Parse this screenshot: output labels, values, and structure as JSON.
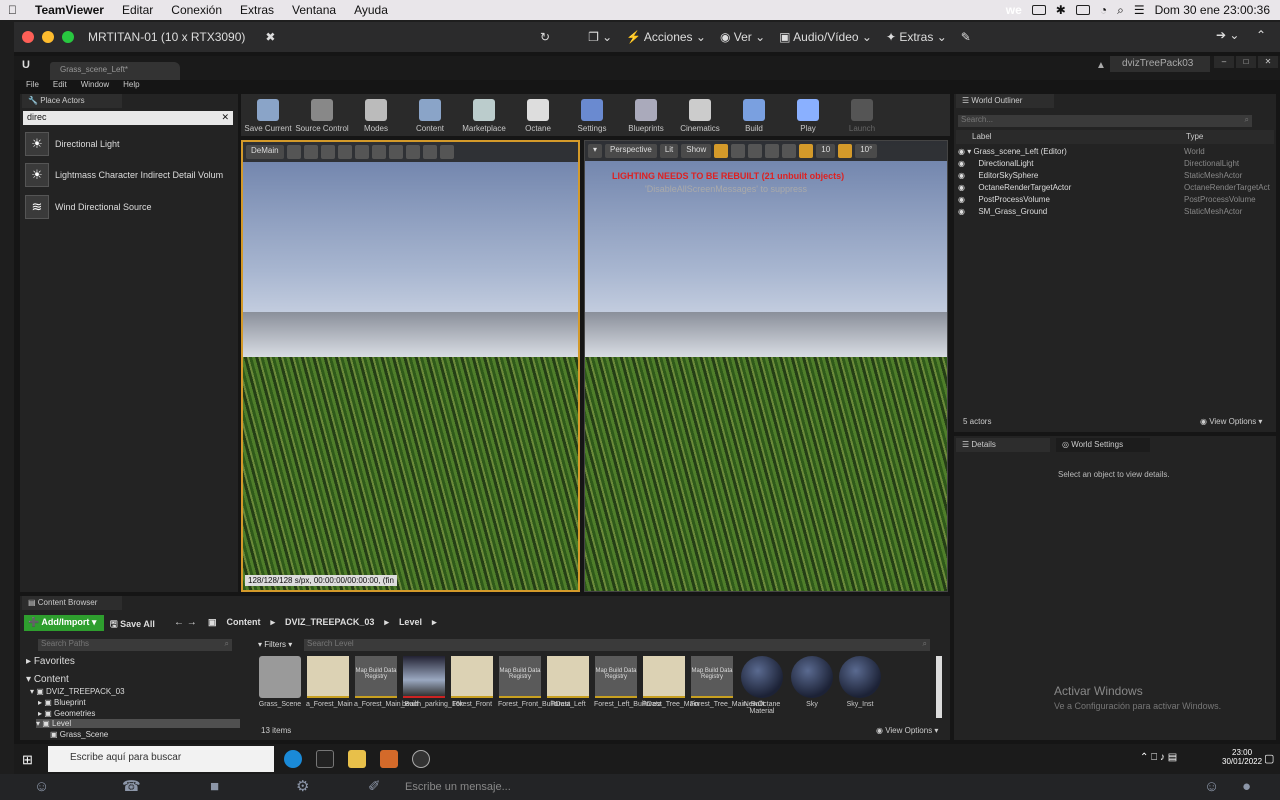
{
  "mac": {
    "app": "TeamViewer",
    "menus": [
      "Editar",
      "Conexión",
      "Extras",
      "Ventana",
      "Ayuda"
    ],
    "datetime": "Dom 30 ene  23:00:36",
    "wifi_label": "we"
  },
  "tv": {
    "title": "MRTITAN-01 (10 x RTX3090)",
    "actions": "Acciones",
    "view": "Ver",
    "audio": "Audio/Vídeo",
    "extras": "Extras"
  },
  "ue": {
    "tab": "Grass_scene_Left*",
    "user": "dvizTreePack03",
    "menus": [
      "File",
      "Edit",
      "Window",
      "Help"
    ]
  },
  "place_actors": {
    "tab": "Place Actors",
    "search": "direc",
    "items": [
      "Directional Light",
      "Lightmass Character Indirect Detail Volum",
      "Wind Directional Source"
    ]
  },
  "toolbar": [
    "Save Current",
    "Source Control",
    "Modes",
    "Content",
    "Marketplace",
    "Octane",
    "Settings",
    "Blueprints",
    "Cinematics",
    "Build",
    "Play",
    "Launch"
  ],
  "viewport1": {
    "mode": "DeMain",
    "status": "128/128/128 s/px, 00:00:00/00:00:00, (fin"
  },
  "viewport2": {
    "perspective": "Perspective",
    "lit": "Lit",
    "show": "Show",
    "snap": "10",
    "angle": "10°",
    "warning": "LIGHTING NEEDS TO BE REBUILT (21 unbuilt objects)",
    "suppress": "'DisableAllScreenMessages' to suppress"
  },
  "outliner": {
    "tab": "World Outliner",
    "search_placeholder": "Search...",
    "col_label": "Label",
    "col_type": "Type",
    "rows": [
      {
        "label": "Grass_scene_Left (Editor)",
        "type": "World"
      },
      {
        "label": "DirectionalLight",
        "type": "DirectionalLight"
      },
      {
        "label": "EditorSkySphere",
        "type": "StaticMeshActor"
      },
      {
        "label": "OctaneRenderTargetActor",
        "type": "OctaneRenderTargetAct"
      },
      {
        "label": "PostProcessVolume",
        "type": "PostProcessVolume"
      },
      {
        "label": "SM_Grass_Ground",
        "type": "StaticMeshActor"
      }
    ],
    "count": "5 actors",
    "view_options": "View Options"
  },
  "details": {
    "tab": "Details",
    "world_tab": "World Settings",
    "empty": "Select an object to view details."
  },
  "activate": {
    "title": "Activar Windows",
    "sub": "Ve a Configuración para activar Windows."
  },
  "content_browser": {
    "tab": "Content Browser",
    "add": "Add/Import",
    "save_all": "Save All",
    "path": [
      "Content",
      "DVIZ_TREEPACK_03",
      "Level"
    ],
    "search_paths": "Search Paths",
    "favorites": "Favorites",
    "tree": [
      "Content",
      "DVIZ_TREEPACK_03",
      "Blueprint",
      "Geometries",
      "Level",
      "Grass_Scene"
    ],
    "filters": "Filters",
    "search_level": "Search Level",
    "assets": [
      "Grass_Scene",
      "a_Forest_Main",
      "a_Forest_Main_Built",
      "beach_parking_16k",
      "Forest_Front",
      "Forest_Front_BuiltData",
      "Forest_Left",
      "Forest_Left_BuiltData",
      "Forest_Tree_Main",
      "Forest_Tree_Main_Built",
      "NewOctane Material",
      "Sky",
      "Sky_Inst"
    ],
    "map_build": "Map Build Data Registry",
    "count": "13 items",
    "view_options": "View Options"
  },
  "taskbar": {
    "search": "Escribe aquí para buscar",
    "time": "23:00",
    "date": "30/01/2022"
  },
  "chat": {
    "placeholder": "Escribe un mensaje..."
  }
}
